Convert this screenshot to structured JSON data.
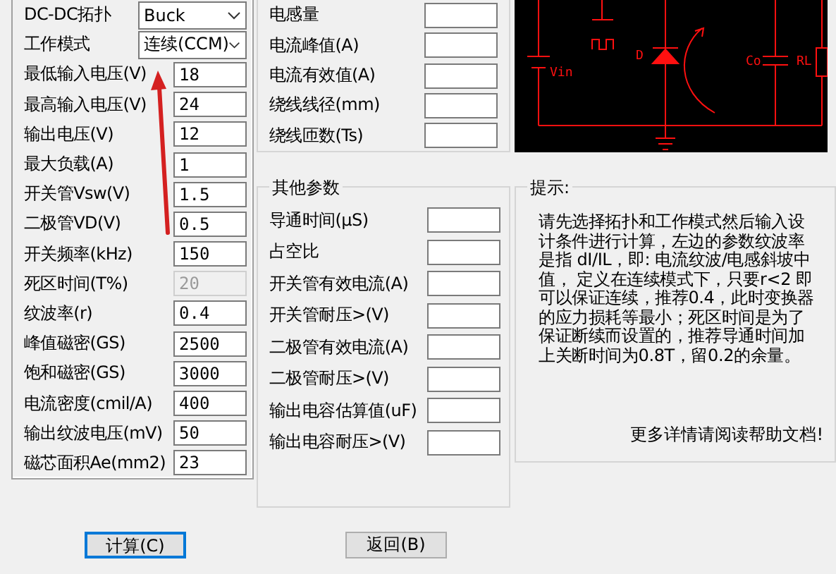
{
  "inputs": {
    "rows": [
      {
        "kind": "select",
        "label": "DC-DC拓扑",
        "value": "Buck",
        "disabled": false
      },
      {
        "kind": "select",
        "label": "工作模式",
        "value": "连续(CCM)",
        "disabled": false
      },
      {
        "kind": "input",
        "label": "最低输入电压(V)",
        "value": "18",
        "disabled": false
      },
      {
        "kind": "input",
        "label": "最高输入电压(V)",
        "value": "24",
        "disabled": false
      },
      {
        "kind": "input",
        "label": "输出电压(V)",
        "value": "12",
        "disabled": false
      },
      {
        "kind": "input",
        "label": "最大负载(A)",
        "value": "1",
        "disabled": false
      },
      {
        "kind": "input",
        "label": "开关管Vsw(V)",
        "value": "1.5",
        "disabled": false
      },
      {
        "kind": "input",
        "label": "二极管VD(V)",
        "value": "0.5",
        "disabled": false
      },
      {
        "kind": "input",
        "label": "开关频率(kHz)",
        "value": "150",
        "disabled": false
      },
      {
        "kind": "input",
        "label": "死区时间(T%)",
        "value": "20",
        "disabled": true
      },
      {
        "kind": "input",
        "label": "纹波率(r)",
        "value": "0.4",
        "disabled": false
      },
      {
        "kind": "input",
        "label": "峰值磁密(GS)",
        "value": "2500",
        "disabled": false
      },
      {
        "kind": "input",
        "label": "饱和磁密(GS)",
        "value": "3000",
        "disabled": false
      },
      {
        "kind": "input",
        "label": "电流密度(cmil/A)",
        "value": "400",
        "disabled": false
      },
      {
        "kind": "input",
        "label": "输出纹波电压(mV)",
        "value": "50",
        "disabled": false
      },
      {
        "kind": "input",
        "label": "磁芯面积Ae(mm2)",
        "value": "23",
        "disabled": false
      }
    ]
  },
  "inductor_results": {
    "rows": [
      {
        "label": "电感量"
      },
      {
        "label": "电流峰值(A)"
      },
      {
        "label": "电流有效值(A)"
      },
      {
        "label": "绕线线径(mm)"
      },
      {
        "label": "绕线匝数(Ts)"
      }
    ]
  },
  "other_params": {
    "title": "其他参数",
    "rows": [
      {
        "label": "导通时间(μS)"
      },
      {
        "label": "占空比"
      },
      {
        "label": "开关管有效电流(A)"
      },
      {
        "label": "开关管耐压>(V)"
      },
      {
        "label": "二极管有效电流(A)"
      },
      {
        "label": "二极管耐压>(V)"
      },
      {
        "label": "输出电容估算值(uF)"
      },
      {
        "label": "输出电容耐压>(V)"
      }
    ]
  },
  "circuit": {
    "labels": [
      "Vin",
      "D",
      "Co",
      "RL"
    ]
  },
  "tips": {
    "title": "提示:",
    "text": "请先选择拓扑和工作模式然后输入设计条件进行计算，左边的参数纹波率是指  dI/IL，即:  电流纹波/电感斜坡中值，  定义在连续模式下，只要r<2 即可以保证连续，推荐0.4，此时变换器的应力损耗等最小；死区时间是为了保证断续而设置的，推荐导通时间加上关断时间为0.8T，留0.2的余量。",
    "more": "更多详情请阅读帮助文档!"
  },
  "buttons": [
    {
      "label": "计算(C)",
      "default": true
    },
    {
      "label": "返回(B)",
      "default": false
    }
  ]
}
